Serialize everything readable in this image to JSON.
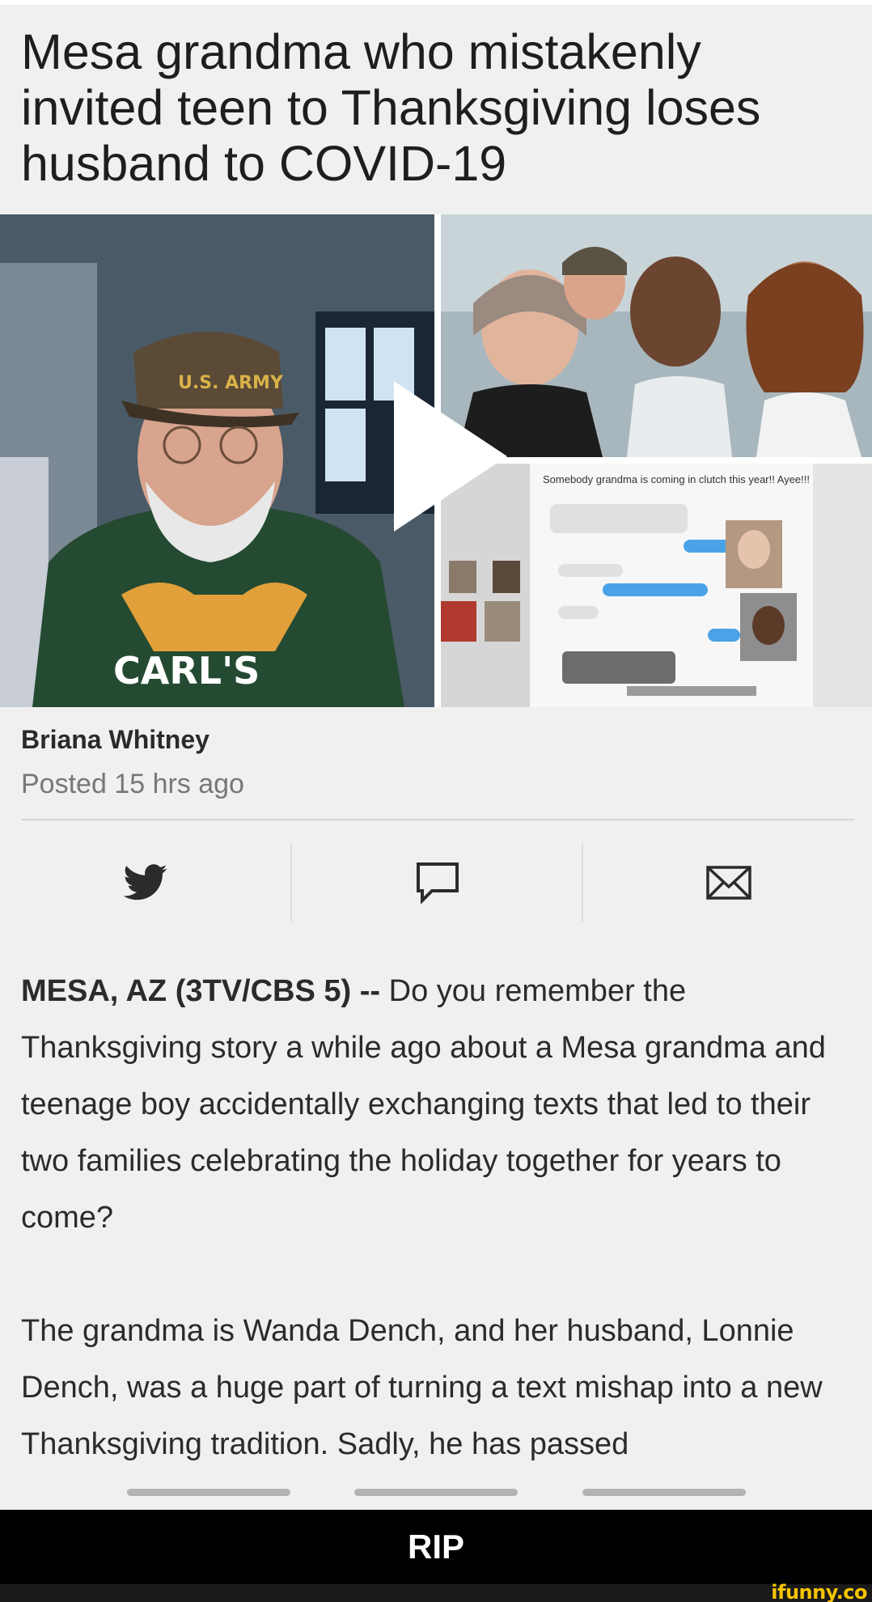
{
  "article": {
    "headline": "Mesa grandma who mistakenly invited teen to Thanksgiving loses husband to COVID-19",
    "author": "Briana Whitney",
    "posted": "Posted 15 hrs ago",
    "dateline": "MESA, AZ (3TV/CBS 5) --",
    "paragraph1": " Do you remember the Thanksgiving story a while ago about a Mesa grandma and teenage boy accidentally exchanging texts that led to their two families celebrating the holiday together for years to come?",
    "paragraph2": "The grandma is Wanda Dench, and her husband, Lonnie Dench, was a huge part of turning a text mishap into a new Thanksgiving tradition. Sadly, he has passed"
  },
  "media": {
    "tweet_text": "Somebody grandma is coming in clutch this year!! Ayee!!!",
    "cap_text": "U.S. ARMY",
    "shirt_text": "CARL'S",
    "play_icon": "play-icon"
  },
  "share": {
    "items": [
      {
        "icon": "twitter-icon"
      },
      {
        "icon": "comment-icon"
      },
      {
        "icon": "mail-icon"
      }
    ]
  },
  "caption": "RIP",
  "watermark": "ifunny.co",
  "colors": {
    "background": "#f0f0f0",
    "caption_bar": "#000000",
    "watermark": "#f5c400",
    "icon": "#2b2b2b"
  }
}
